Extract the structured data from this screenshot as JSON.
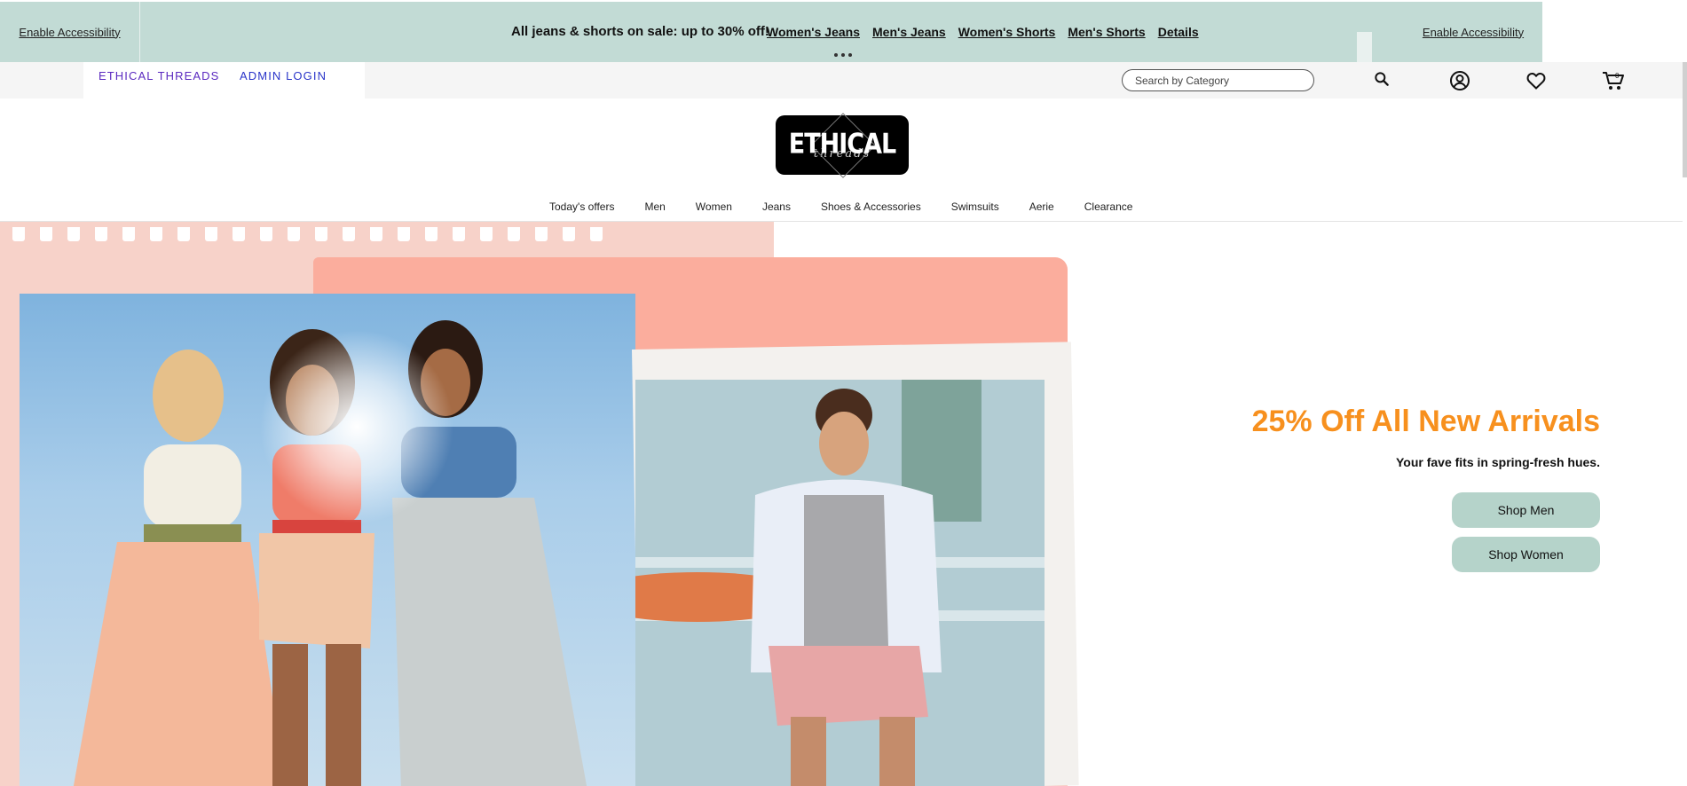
{
  "promo": {
    "accessibility_left": "Enable Accessibility",
    "accessibility_right": "Enable Accessibility",
    "message": "All jeans & shorts on sale: up to 30% off!",
    "links": [
      "Women's Jeans",
      "Men's Jeans",
      "Women's Shorts",
      "Men's Shorts",
      "Details"
    ],
    "background_color": "#c2dbd5"
  },
  "utility": {
    "brand_link": "ETHICAL THREADS",
    "admin_link": "ADMIN LOGIN",
    "search_placeholder": "Search by Category",
    "icons": [
      "search-icon",
      "account-icon",
      "wishlist-heart-icon",
      "cart-icon"
    ]
  },
  "logo": {
    "line1": "ETHICAL",
    "line2": "threads"
  },
  "nav": {
    "items": [
      "Today's offers",
      "Men",
      "Women",
      "Jeans",
      "Shoes & Accessories",
      "Swimsuits",
      "Aerie",
      "Clearance"
    ]
  },
  "hero": {
    "headline": "25% Off All New Arrivals",
    "subline": "Your fave fits in spring-fresh hues.",
    "cta_men": "Shop Men",
    "cta_women": "Shop Women",
    "headline_color": "#f7901e",
    "cta_color": "#b5d3ca"
  }
}
